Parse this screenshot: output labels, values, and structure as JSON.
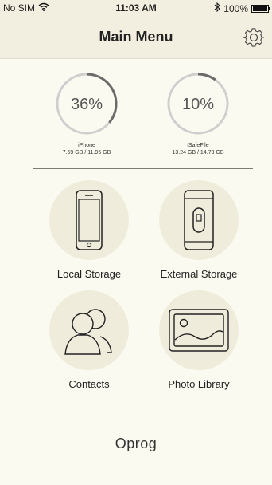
{
  "status_bar": {
    "carrier": "No SIM",
    "time": "11:03 AM",
    "battery": "100%",
    "icons": [
      "wifi-icon",
      "bluetooth-icon",
      "battery-icon"
    ]
  },
  "nav": {
    "title": "Main Menu",
    "settings_icon": "gear-icon"
  },
  "gauges": [
    {
      "percent_label": "36%",
      "percent": 36,
      "name": "iPhone",
      "size": "7.59 GB / 11.95 GB"
    },
    {
      "percent_label": "10%",
      "percent": 10,
      "name": "iSafeFile",
      "size": "13.24 GB / 14.73 GB"
    }
  ],
  "menu": [
    {
      "label": "Local Storage",
      "icon": "smartphone-icon"
    },
    {
      "label": "External Storage",
      "icon": "external-drive-icon"
    },
    {
      "label": "Contacts",
      "icon": "contacts-icon"
    },
    {
      "label": "Photo Library",
      "icon": "photo-icon"
    }
  ],
  "brand": {
    "logo_text": "Oprog"
  },
  "colors": {
    "background": "#fbfaf0",
    "bar": "#f3efe0",
    "gauge_track": "#cfcfcf",
    "gauge_progress": "#6b6b6b"
  }
}
